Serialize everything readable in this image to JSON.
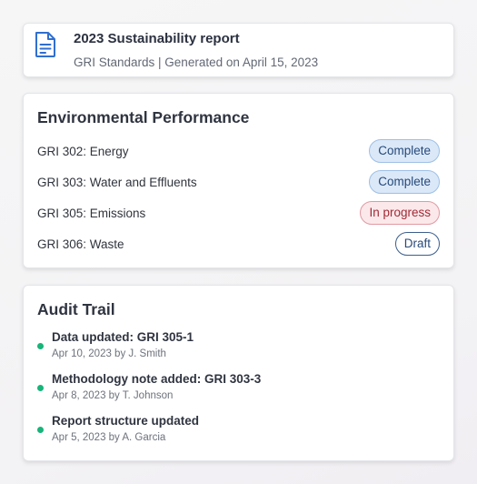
{
  "report": {
    "title": "2023 Sustainability report",
    "subtitle": "GRI Standards | Generated on April 15, 2023",
    "icon": "document-icon"
  },
  "environmental": {
    "title": "Environmental Performance",
    "rows": [
      {
        "label": "GRI 302: Energy",
        "status": "Complete"
      },
      {
        "label": "GRI 303: Water and Effluents",
        "status": "Complete"
      },
      {
        "label": "GRI 305: Emissions",
        "status": "In progress"
      },
      {
        "label": "GRI 306: Waste",
        "status": "Draft"
      }
    ]
  },
  "audit": {
    "title": "Audit Trail",
    "items": [
      {
        "title": "Data updated: GRI 305-1",
        "meta": "Apr 10, 2023 by J. Smith"
      },
      {
        "title": "Methodology note added: GRI 303-3",
        "meta": "Apr 8, 2023 by T. Johnson"
      },
      {
        "title": "Report structure updated",
        "meta": "Apr 5, 2023 by A. Garcia"
      }
    ]
  },
  "colors": {
    "accent": "#2f6fd0",
    "complete_bg": "#dbe8f8",
    "in_progress_bg": "#fbe8ea",
    "draft_border": "#3c5e8c",
    "audit_dot": "#18b47a"
  }
}
